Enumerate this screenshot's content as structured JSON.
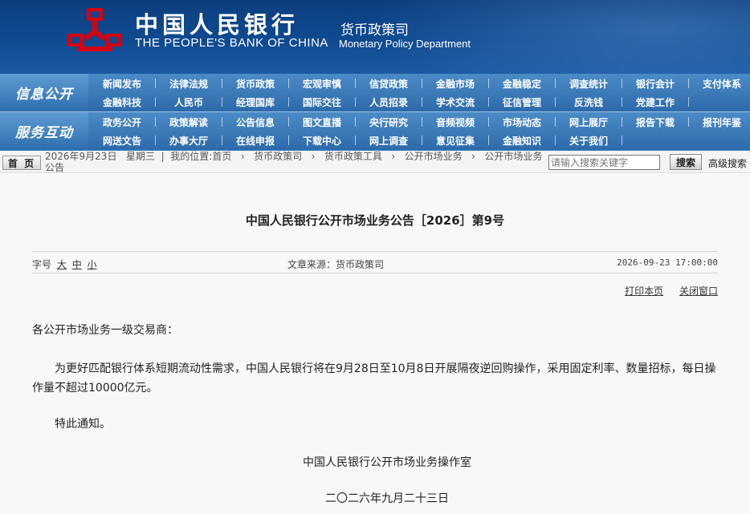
{
  "header": {
    "bank_cn": "中国人民银行",
    "bank_en": "THE PEOPLE'S BANK OF CHINA",
    "dept_cn": "货币政策司",
    "dept_en": "Monetary Policy Department",
    "logo_icon": "pboc-logo-icon",
    "logo_color": "#d7000f"
  },
  "nav": {
    "section1_label": "信息公开",
    "section1_items": [
      "新闻发布",
      "法律法规",
      "货币政策",
      "宏观审慎",
      "信贷政策",
      "金融市场",
      "金融稳定",
      "调查统计",
      "银行会计",
      "支付体系",
      "金融科技",
      "人民币",
      "经理国库",
      "国际交往",
      "人员招录",
      "学术交流",
      "征信管理",
      "反洗钱",
      "党建工作"
    ],
    "section2_label": "服务互动",
    "section2_items": [
      "政务公开",
      "政策解读",
      "公告信息",
      "图文直播",
      "央行研究",
      "音频视频",
      "市场动态",
      "网上展厅",
      "报告下载",
      "报刊年鉴",
      "网送文告",
      "办事大厅",
      "在线申报",
      "下载中心",
      "网上调查",
      "意见征集",
      "金融知识",
      "关于我们"
    ]
  },
  "breadcrumb": {
    "home_label": "首 页",
    "date": "2026年9月23日",
    "weekday": "星期三",
    "location_label": "我的位置:",
    "items": [
      "首页",
      "货币政策司",
      "货币政策工具",
      "公开市场业务",
      "公开市场业务公告"
    ],
    "separator": "›"
  },
  "search": {
    "placeholder": "请输入搜索关键字",
    "button_label": "搜索",
    "advanced_label": "高级搜索"
  },
  "article": {
    "title": "中国人民银行公开市场业务公告［2026］第9号",
    "font_size_label": "字号",
    "font_sizes": [
      "大",
      "中",
      "小"
    ],
    "source": "文章来源：货币政策司",
    "date": "2026-09-23 17:00:00",
    "print_label": "打印本页",
    "close_label": "关闭窗口",
    "salutation": "各公开市场业务一级交易商：",
    "paragraph": "为更好匹配银行体系短期流动性需求，中国人民银行将在9月28日至10月8日开展隔夜逆回购操作，采用固定利率、数量招标，每日操作量不超过10000亿元。",
    "closing": "特此通知。",
    "signature": "中国人民银行公开市场业务操作室",
    "sign_date": "二〇二六年九月二十三日"
  }
}
